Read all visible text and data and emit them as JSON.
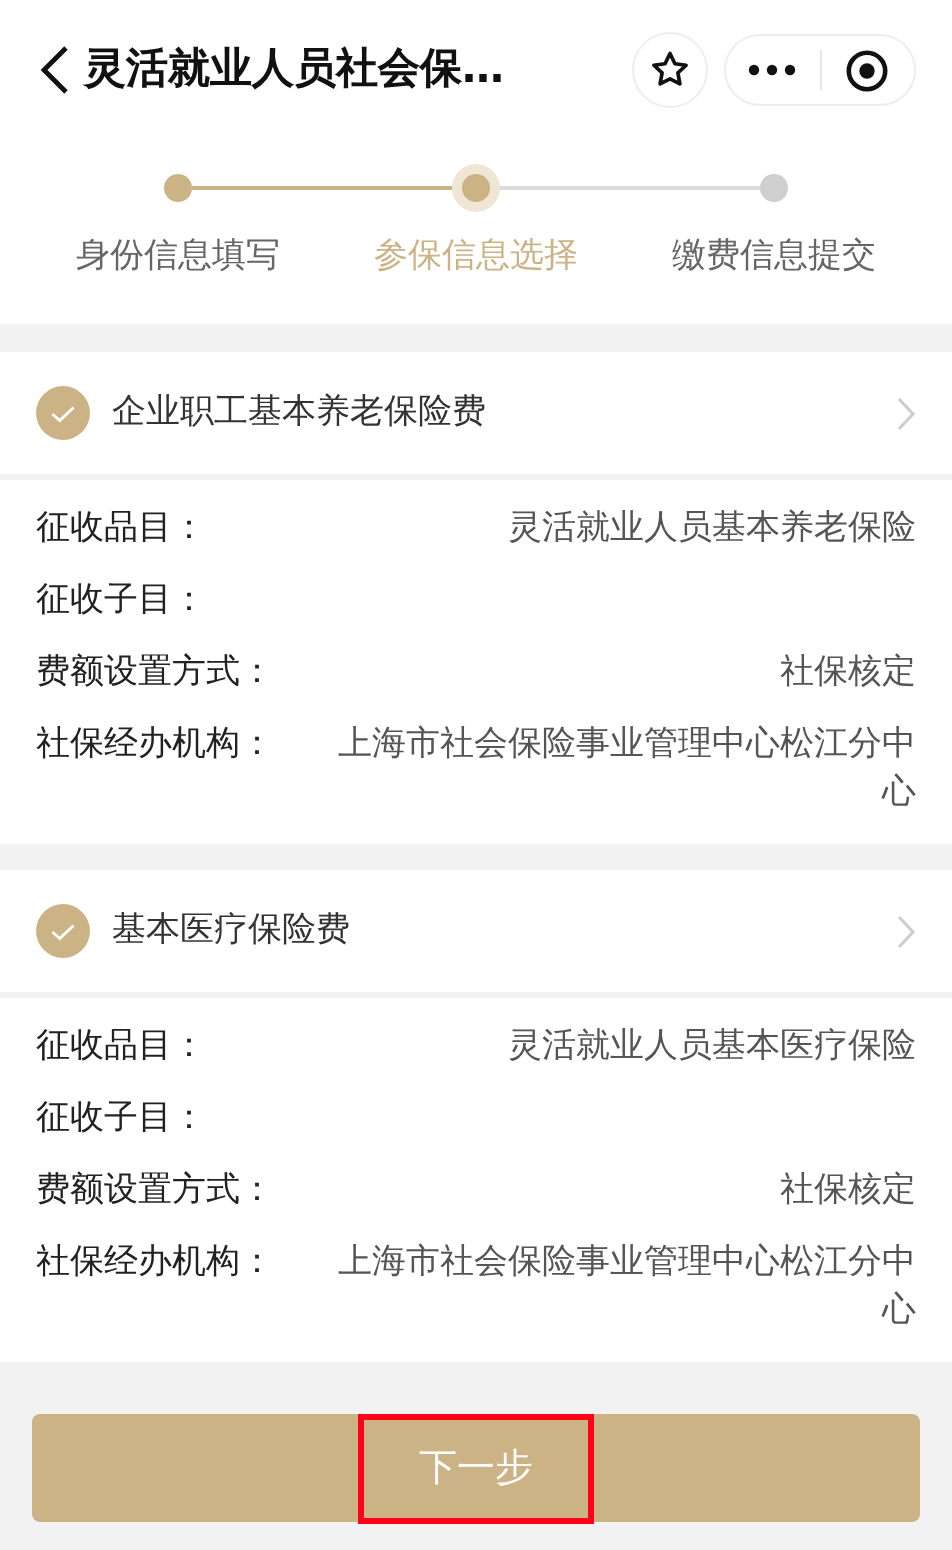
{
  "header": {
    "title": "灵活就业人员社会保…"
  },
  "steps": [
    {
      "label": "身份信息填写",
      "kind": "done"
    },
    {
      "label": "参保信息选择",
      "kind": "current"
    },
    {
      "label": "缴费信息提交",
      "kind": "todo"
    }
  ],
  "sections": [
    {
      "title": "企业职工基本养老保险费",
      "checked": true,
      "fields": [
        {
          "label": "征收品目：",
          "value": "灵活就业人员基本养老保险"
        },
        {
          "label": "征收子目："
        },
        {
          "label": "费额设置方式：",
          "value": "社保核定"
        },
        {
          "label": "社保经办机构：",
          "value": "上海市社会保险事业管理中心松江分中心"
        }
      ]
    },
    {
      "title": "基本医疗保险费",
      "checked": true,
      "fields": [
        {
          "label": "征收品目：",
          "value": "灵活就业人员基本医疗保险"
        },
        {
          "label": "征收子目："
        },
        {
          "label": "费额设置方式：",
          "value": "社保核定"
        },
        {
          "label": "社保经办机构：",
          "value": "上海市社会保险事业管理中心松江分中心"
        }
      ]
    }
  ],
  "next_button": {
    "label": "下一步",
    "highlighted": true
  }
}
